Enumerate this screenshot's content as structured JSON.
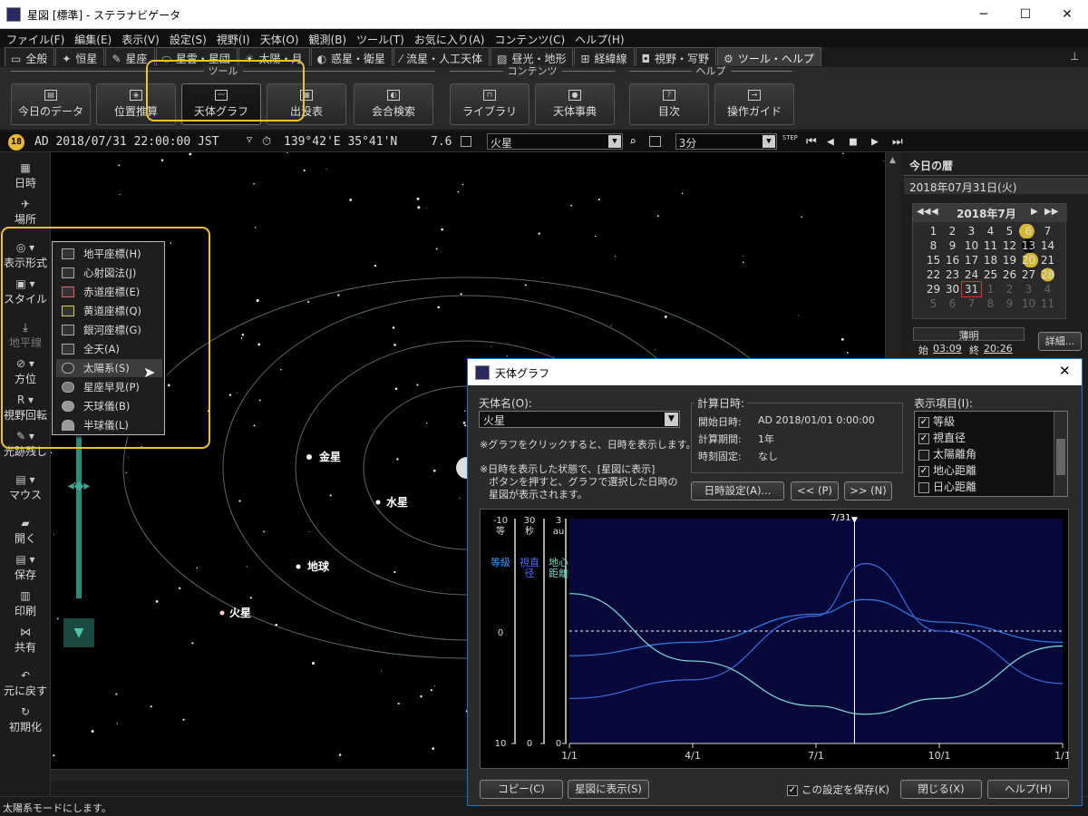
{
  "window": {
    "title": "星図 [標準] - ステラナビゲータ",
    "min": "─",
    "max": "☐",
    "close": "✕"
  },
  "menu": [
    "ファイル(F)",
    "編集(E)",
    "表示(V)",
    "設定(S)",
    "視野(I)",
    "天体(O)",
    "観測(B)",
    "ツール(T)",
    "お気に入り(A)",
    "コンテンツ(C)",
    "ヘルプ(H)"
  ],
  "tabs": [
    {
      "label": "全般",
      "icon": "▭"
    },
    {
      "label": "恒星",
      "icon": "✦"
    },
    {
      "label": "星座",
      "icon": "✎"
    },
    {
      "label": "星雲・星団",
      "icon": "⬭"
    },
    {
      "label": "太陽・月",
      "icon": "☀"
    },
    {
      "label": "惑星・衛星",
      "icon": "◐"
    },
    {
      "label": "流星・人工天体",
      "icon": "⁄"
    },
    {
      "label": "昼光・地形",
      "icon": "▨"
    },
    {
      "label": "経緯線",
      "icon": "⊞"
    },
    {
      "label": "視野・写野",
      "icon": "◘"
    },
    {
      "label": "ツール・ヘルプ",
      "icon": "⚙"
    }
  ],
  "pin": "⊥",
  "toolbar": {
    "groups": [
      {
        "label": "ツール"
      },
      {
        "label": "コンテンツ"
      },
      {
        "label": "ヘルプ"
      }
    ],
    "buttons": [
      "今日のデータ",
      "位置推算",
      "天体グラフ",
      "出没表",
      "会合検索",
      "ライブラリ",
      "天体事典",
      "目次",
      "操作ガイド"
    ]
  },
  "infobar": {
    "badge": "18",
    "datetime": "AD 2018/07/31 22:00:00 JST",
    "tz_arrow": "▽",
    "clock_icon": "⏱",
    "location": "139°42'E 35°41'N",
    "mag": "7.6",
    "object": "火星",
    "step": "3分",
    "step_icon": "STEP",
    "controls": [
      "⏮",
      "◀",
      "■",
      "▶",
      "⏭"
    ]
  },
  "sidebar": {
    "items": [
      {
        "label": "日時",
        "icon": "▦"
      },
      {
        "label": "場所",
        "icon": "✈"
      },
      {
        "label": "表示形式",
        "icon": "◎ ▾"
      },
      {
        "label": "スタイル",
        "icon": "▣ ▾"
      },
      {
        "label": "地平線",
        "icon": "⤓"
      },
      {
        "label": "方位",
        "icon": "⊘ ▾"
      },
      {
        "label": "視野回転",
        "icon": "R ▾"
      },
      {
        "label": "光跡残し",
        "icon": "✎ ▾"
      },
      {
        "label": "マウス",
        "icon": "▤ ▾"
      },
      {
        "label": "開く",
        "icon": "▰"
      },
      {
        "label": "保存",
        "icon": "▤ ▾"
      },
      {
        "label": "印刷",
        "icon": "▥"
      },
      {
        "label": "共有",
        "icon": "⋈"
      },
      {
        "label": "元に戻す",
        "icon": "↶"
      },
      {
        "label": "初期化",
        "icon": "↻"
      }
    ],
    "zoom_arrow": "▼"
  },
  "popup_menu": {
    "items": [
      "地平座標(H)",
      "心射図法(J)",
      "赤道座標(E)",
      "黄道座標(Q)",
      "銀河座標(G)",
      "全天(A)",
      "太陽系(S)",
      "星座早見(P)",
      "天球儀(B)",
      "半球儀(L)"
    ],
    "selected": "太陽系(S)"
  },
  "sky": {
    "planets": [
      "金星",
      "水星",
      "地球",
      "火星"
    ]
  },
  "right_panel": {
    "title": "今日の暦",
    "date": "2018年07月31日(火)",
    "month": "2018年7月",
    "nav": [
      "◀◀",
      "◀",
      "▶",
      "▶▶"
    ],
    "calendar": [
      [
        "1",
        "2",
        "3",
        "4",
        "5",
        "6",
        "7"
      ],
      [
        "8",
        "9",
        "10",
        "11",
        "12",
        "13",
        "14"
      ],
      [
        "15",
        "16",
        "17",
        "18",
        "19",
        "20",
        "21"
      ],
      [
        "22",
        "23",
        "24",
        "25",
        "26",
        "27",
        "28"
      ],
      [
        "29",
        "30",
        "31",
        "1",
        "2",
        "3",
        "4"
      ],
      [
        "5",
        "6",
        "7",
        "8",
        "9",
        "10",
        "11"
      ]
    ],
    "twilight": "薄明",
    "start_label": "始",
    "start": "03:09",
    "end_label": "終",
    "end": "20:26",
    "detail_button": "詳細..."
  },
  "status": "太陽系モードにします。",
  "dialog": {
    "title": "天体グラフ",
    "close": "✕",
    "object_label": "天体名(O):",
    "object": "火星",
    "note1": "※グラフをクリックすると、日時を表示します。",
    "note2": [
      "※日時を表示した状態で、[星図に表示]",
      "ボタンを押すと、グラフで選択した日時の",
      "星図が表示されます。"
    ],
    "calc_label": "計算日時:",
    "start_label": "開始日時:",
    "start": "AD 2018/01/01  0:00:00",
    "period_label": "計算期間:",
    "period": "1年",
    "fixed_label": "時刻固定:",
    "fixed": "なし",
    "datetime_button": "日時設定(A)...",
    "prev_button": "<< (P)",
    "next_button": ">> (N)",
    "items_label": "表示項目(I):",
    "items": [
      {
        "label": "等級",
        "checked": true
      },
      {
        "label": "視直径",
        "checked": true
      },
      {
        "label": "太陽離角",
        "checked": false
      },
      {
        "label": "地心距離",
        "checked": true
      },
      {
        "label": "日心距離",
        "checked": false
      }
    ],
    "copy_button": "コピー(C)",
    "show_button": "星図に表示(S)",
    "save_label": "この設定を保存(K)",
    "close_button": "閉じる(X)",
    "help_button": "ヘルプ(H)"
  },
  "chart_data": {
    "type": "line",
    "marker": "7/31",
    "x_ticks": [
      "1/1",
      "4/1",
      "7/1",
      "10/1",
      "1/1"
    ],
    "axes": [
      {
        "top": "-10",
        "unit": "等",
        "mid": "0",
        "bottom": "10",
        "name": "等級",
        "color": "#3b9cff"
      },
      {
        "top": "30",
        "unit": "秒",
        "mid": "",
        "bottom": "0",
        "name": "視直径",
        "color": "#4f6bff"
      },
      {
        "top": "3",
        "unit": "au",
        "mid": "",
        "bottom": "0",
        "name": "地心距離",
        "color": "#6fd6c8"
      }
    ],
    "series": [
      {
        "name": "等級",
        "color": "#2e7fe6",
        "points": [
          [
            0,
            2.2
          ],
          [
            0.25,
            1.0
          ],
          [
            0.5,
            -1.5
          ],
          [
            0.6,
            -2.8
          ],
          [
            0.75,
            -0.8
          ],
          [
            1,
            1.0
          ]
        ]
      },
      {
        "name": "視直径",
        "color": "#3b6be0",
        "points": [
          [
            0,
            6.0
          ],
          [
            0.25,
            8.5
          ],
          [
            0.5,
            17.0
          ],
          [
            0.6,
            24.0
          ],
          [
            0.75,
            15.0
          ],
          [
            1,
            8.0
          ]
        ]
      },
      {
        "name": "地心距離",
        "color": "#7fe0d6",
        "points": [
          [
            0,
            2.0
          ],
          [
            0.25,
            1.1
          ],
          [
            0.5,
            0.5
          ],
          [
            0.6,
            0.39
          ],
          [
            0.75,
            0.6
          ],
          [
            1,
            1.3
          ]
        ]
      }
    ],
    "dashed_line": "0"
  }
}
